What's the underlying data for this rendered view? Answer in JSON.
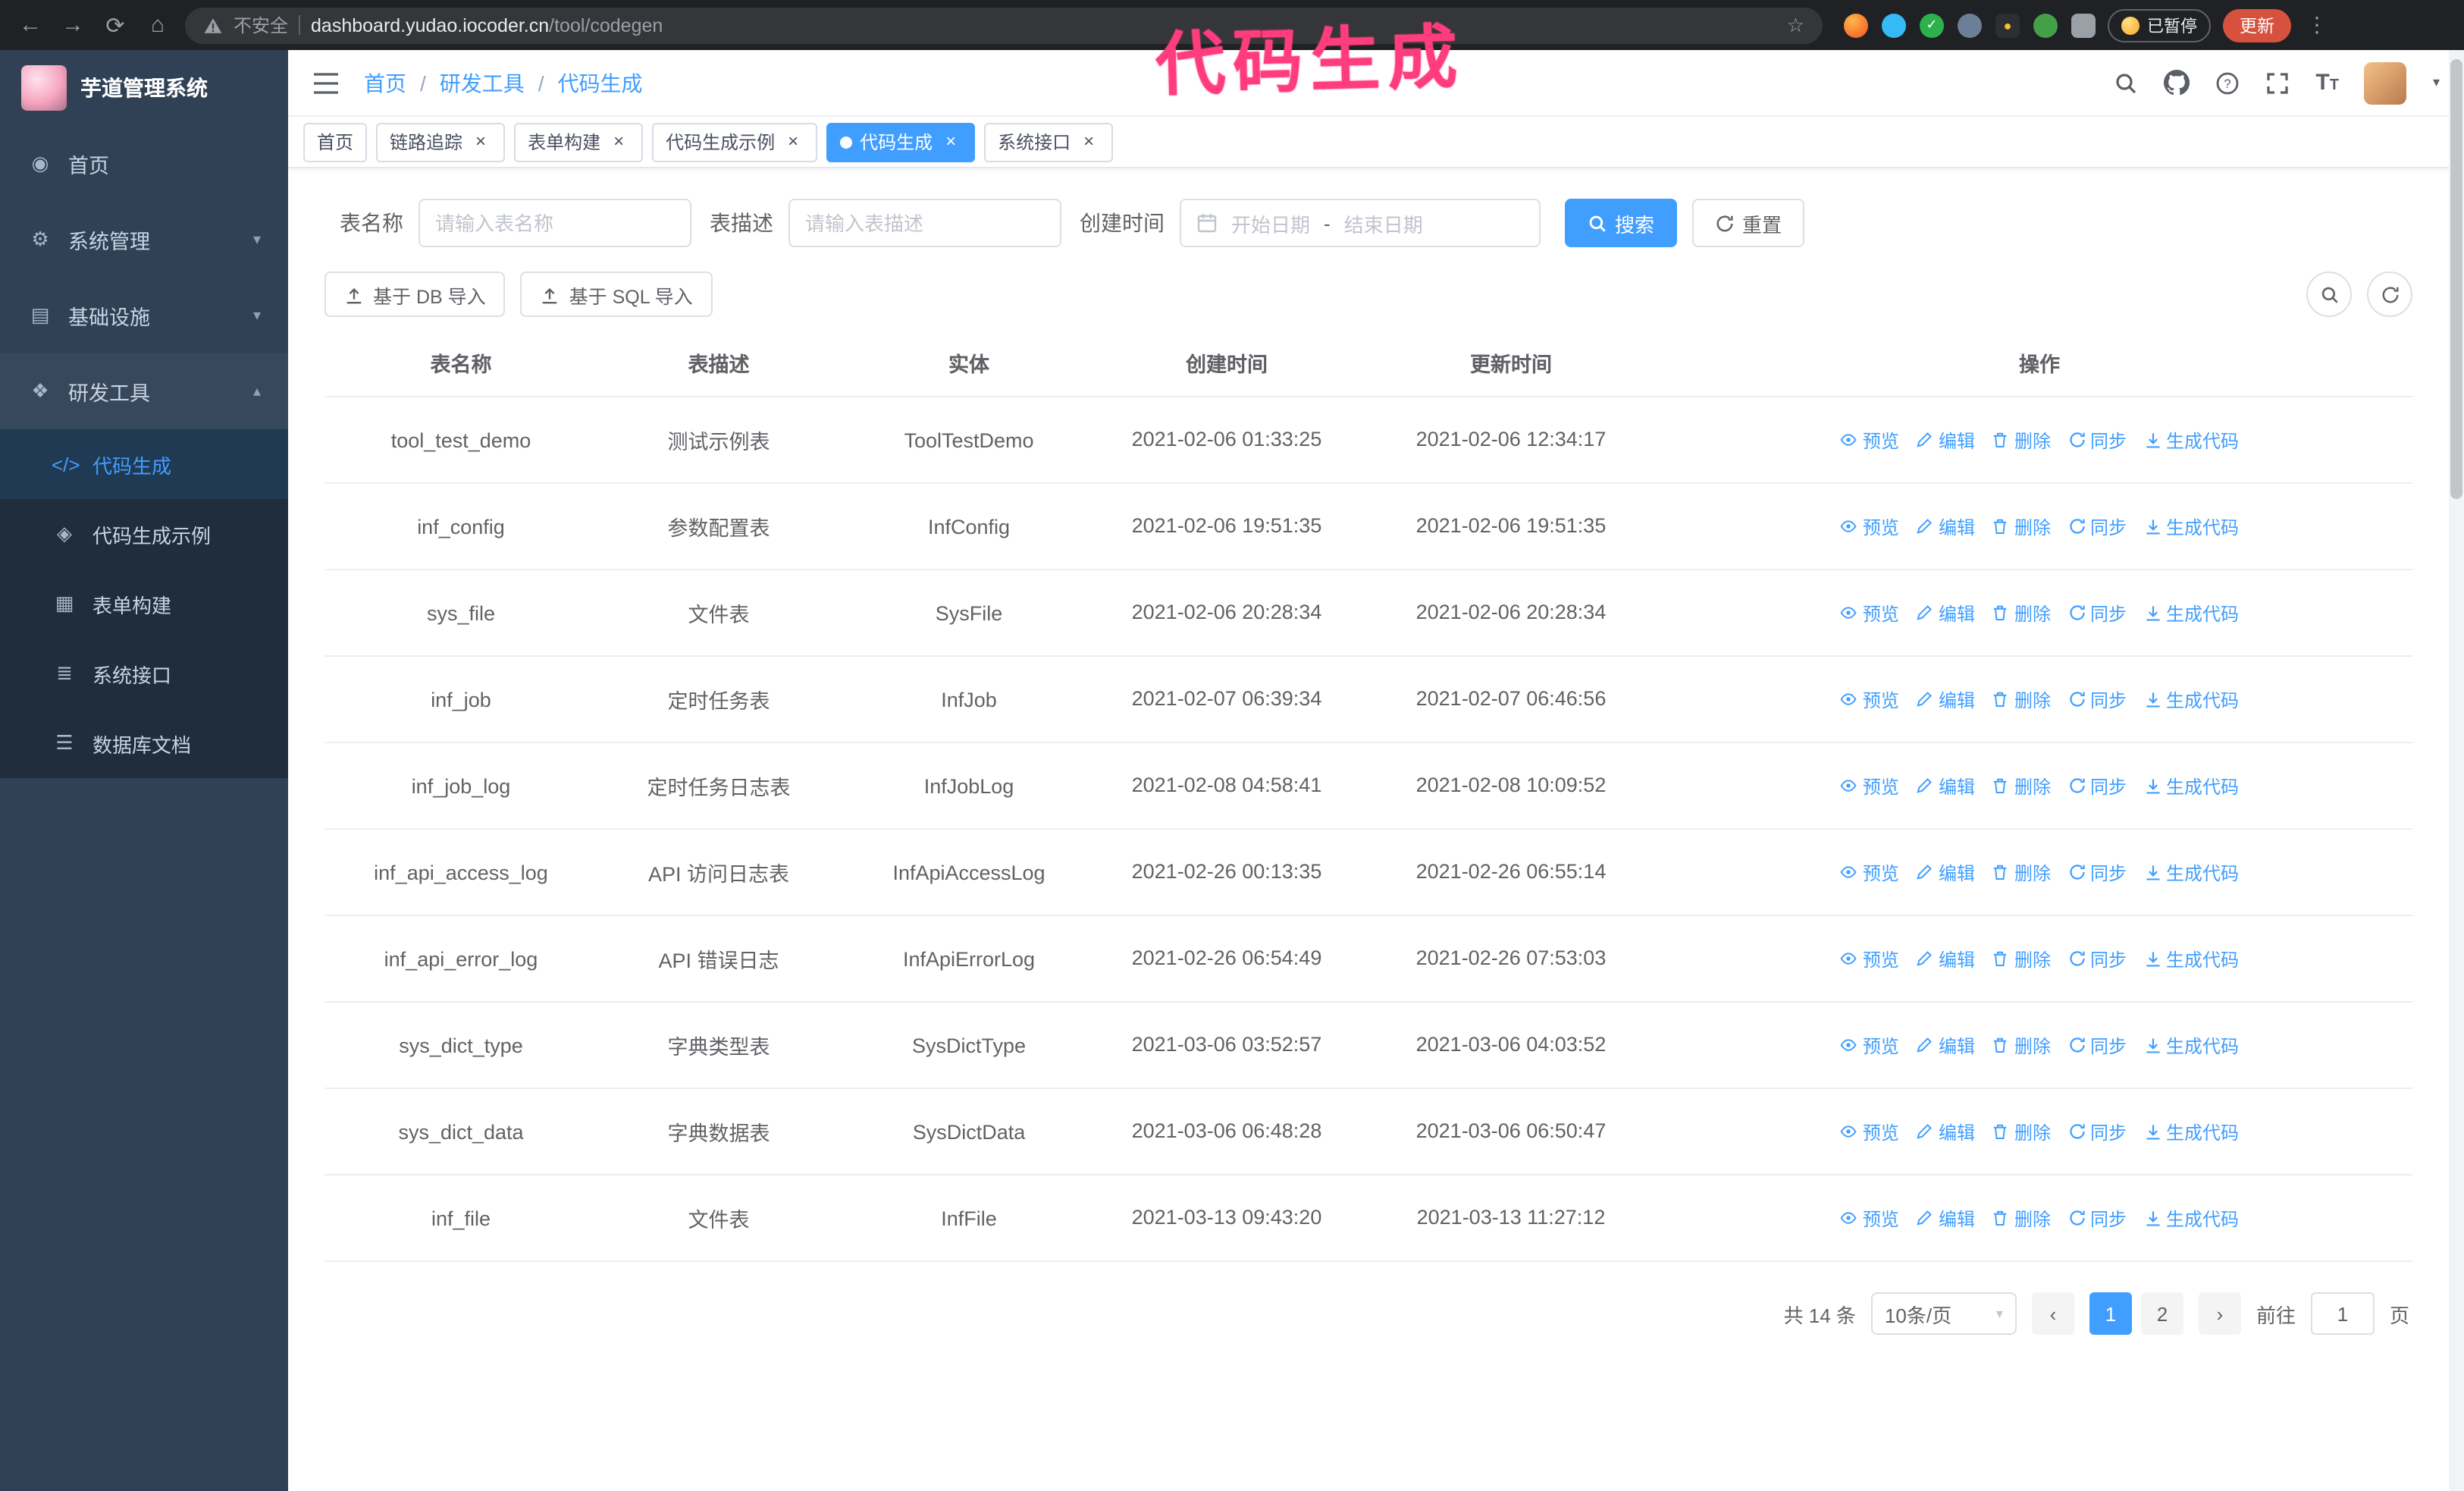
{
  "colors": {
    "accent": "#409eff",
    "annotation_pink": "#ff3d7d",
    "sidebar_bg": "#304156"
  },
  "annotation": {
    "text": "代码生成"
  },
  "browser": {
    "security_text": "不安全",
    "url_domain": "dashboard.yudao.iocoder.cn",
    "url_path": "/tool/codegen",
    "paused_badge": "已暂停",
    "update_label": "更新"
  },
  "sidebar": {
    "title": "芋道管理系统",
    "items": [
      {
        "label": "首页",
        "icon": "home"
      },
      {
        "label": "系统管理",
        "icon": "gear",
        "chevron": "down"
      },
      {
        "label": "基础设施",
        "icon": "infra",
        "chevron": "down"
      },
      {
        "label": "研发工具",
        "icon": "tools",
        "chevron": "up",
        "expanded": true
      }
    ],
    "subitems": [
      {
        "label": "代码生成",
        "icon": "code",
        "active": true
      },
      {
        "label": "代码生成示例",
        "icon": "badge"
      },
      {
        "label": "表单构建",
        "icon": "form"
      },
      {
        "label": "系统接口",
        "icon": "api"
      },
      {
        "label": "数据库文档",
        "icon": "db"
      }
    ]
  },
  "header": {
    "breadcrumb": [
      "首页",
      "研发工具",
      "代码生成"
    ]
  },
  "tabs": [
    {
      "label": "首页",
      "closable": false,
      "active": false
    },
    {
      "label": "链路追踪",
      "closable": true,
      "active": false
    },
    {
      "label": "表单构建",
      "closable": true,
      "active": false
    },
    {
      "label": "代码生成示例",
      "closable": true,
      "active": false
    },
    {
      "label": "代码生成",
      "closable": true,
      "active": true
    },
    {
      "label": "系统接口",
      "closable": true,
      "active": false
    }
  ],
  "filter": {
    "name_label": "表名称",
    "name_placeholder": "请输入表名称",
    "desc_label": "表描述",
    "desc_placeholder": "请输入表描述",
    "time_label": "创建时间",
    "start_placeholder": "开始日期",
    "range_separator": "-",
    "end_placeholder": "结束日期",
    "search_label": "搜索",
    "reset_label": "重置"
  },
  "toolbar": {
    "import_db": "基于 DB 导入",
    "import_sql": "基于 SQL 导入"
  },
  "table": {
    "columns": [
      "表名称",
      "表描述",
      "实体",
      "创建时间",
      "更新时间",
      "操作"
    ],
    "actions": [
      "预览",
      "编辑",
      "删除",
      "同步",
      "生成代码"
    ],
    "rows": [
      {
        "name": "tool_test_demo",
        "desc": "测试示例表",
        "entity": "ToolTestDemo",
        "created": "2021-02-06 01:33:25",
        "updated": "2021-02-06 12:34:17"
      },
      {
        "name": "inf_config",
        "desc": "参数配置表",
        "entity": "InfConfig",
        "created": "2021-02-06 19:51:35",
        "updated": "2021-02-06 19:51:35"
      },
      {
        "name": "sys_file",
        "desc": "文件表",
        "entity": "SysFile",
        "created": "2021-02-06 20:28:34",
        "updated": "2021-02-06 20:28:34"
      },
      {
        "name": "inf_job",
        "desc": "定时任务表",
        "entity": "InfJob",
        "created": "2021-02-07 06:39:34",
        "updated": "2021-02-07 06:46:56"
      },
      {
        "name": "inf_job_log",
        "desc": "定时任务日志表",
        "entity": "InfJobLog",
        "created": "2021-02-08 04:58:41",
        "updated": "2021-02-08 10:09:52"
      },
      {
        "name": "inf_api_access_log",
        "desc": "API 访问日志表",
        "entity": "InfApiAccessLog",
        "created": "2021-02-26 00:13:35",
        "updated": "2021-02-26 06:55:14"
      },
      {
        "name": "inf_api_error_log",
        "desc": "API 错误日志",
        "entity": "InfApiErrorLog",
        "created": "2021-02-26 06:54:49",
        "updated": "2021-02-26 07:53:03"
      },
      {
        "name": "sys_dict_type",
        "desc": "字典类型表",
        "entity": "SysDictType",
        "created": "2021-03-06 03:52:57",
        "updated": "2021-03-06 04:03:52"
      },
      {
        "name": "sys_dict_data",
        "desc": "字典数据表",
        "entity": "SysDictData",
        "created": "2021-03-06 06:48:28",
        "updated": "2021-03-06 06:50:47"
      },
      {
        "name": "inf_file",
        "desc": "文件表",
        "entity": "InfFile",
        "created": "2021-03-13 09:43:20",
        "updated": "2021-03-13 11:27:12"
      }
    ]
  },
  "pagination": {
    "total": "共 14 条",
    "page_size": "10条/页",
    "pages": [
      "1",
      "2"
    ],
    "active_page": "1",
    "goto_label": "前往",
    "goto_value": "1",
    "goto_suffix": "页"
  }
}
